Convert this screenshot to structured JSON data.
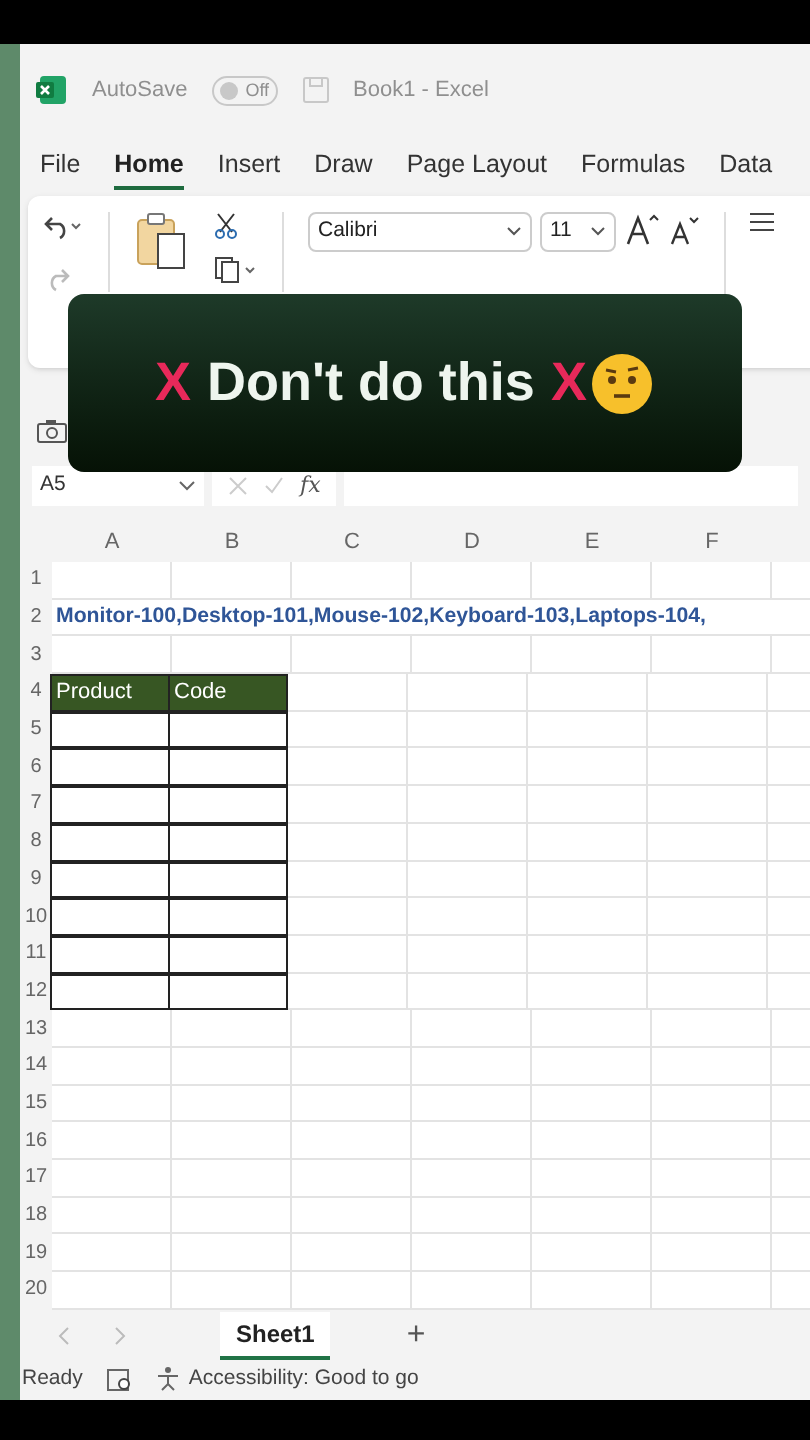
{
  "title_bar": {
    "autosave_label": "AutoSave",
    "autosave_toggle": {
      "label": "Off",
      "on": false
    },
    "document_title": "Book1 - Excel"
  },
  "menu_tabs": [
    {
      "label": "File",
      "selected": false
    },
    {
      "label": "Home",
      "selected": true
    },
    {
      "label": "Insert",
      "selected": false
    },
    {
      "label": "Draw",
      "selected": false
    },
    {
      "label": "Page Layout",
      "selected": false
    },
    {
      "label": "Formulas",
      "selected": false
    },
    {
      "label": "Data",
      "selected": false
    }
  ],
  "ribbon": {
    "font_name": "Calibri",
    "font_size": "11"
  },
  "caption_overlay": {
    "parts": [
      {
        "text": "X",
        "kind": "cross"
      },
      {
        "text": "Don't do this",
        "kind": "words"
      },
      {
        "text": "X",
        "kind": "cross"
      }
    ]
  },
  "formula_bar": {
    "name_box": "A5",
    "function_label": "fx"
  },
  "sheet": {
    "columns": [
      "A",
      "B",
      "C",
      "D",
      "E",
      "F"
    ],
    "rows": [
      {
        "number": "1",
        "kind": "blank"
      },
      {
        "number": "2",
        "kind": "text",
        "overflow_text": "Monitor-100,Desktop-101,Mouse-102,Keyboard-103,Laptops-104,"
      },
      {
        "number": "3",
        "kind": "blank"
      },
      {
        "number": "4",
        "kind": "table_header",
        "cells": [
          "Product",
          "Code"
        ]
      },
      {
        "number": "5",
        "kind": "table_body"
      },
      {
        "number": "6",
        "kind": "table_body"
      },
      {
        "number": "7",
        "kind": "table_body"
      },
      {
        "number": "8",
        "kind": "table_body"
      },
      {
        "number": "9",
        "kind": "table_body"
      },
      {
        "number": "10",
        "kind": "table_body"
      },
      {
        "number": "11",
        "kind": "table_body"
      },
      {
        "number": "12",
        "kind": "table_body"
      },
      {
        "number": "13",
        "kind": "blank"
      },
      {
        "number": "14",
        "kind": "blank"
      },
      {
        "number": "15",
        "kind": "blank"
      },
      {
        "number": "16",
        "kind": "blank"
      },
      {
        "number": "17",
        "kind": "blank"
      },
      {
        "number": "18",
        "kind": "blank"
      },
      {
        "number": "19",
        "kind": "blank"
      },
      {
        "number": "20",
        "kind": "blank"
      }
    ]
  },
  "sheet_tabs": [
    {
      "label": "Sheet1",
      "selected": true
    }
  ],
  "add_sheet": "+",
  "status_bar": {
    "mode": "Ready",
    "accessibility": "Accessibility: Good to go"
  }
}
